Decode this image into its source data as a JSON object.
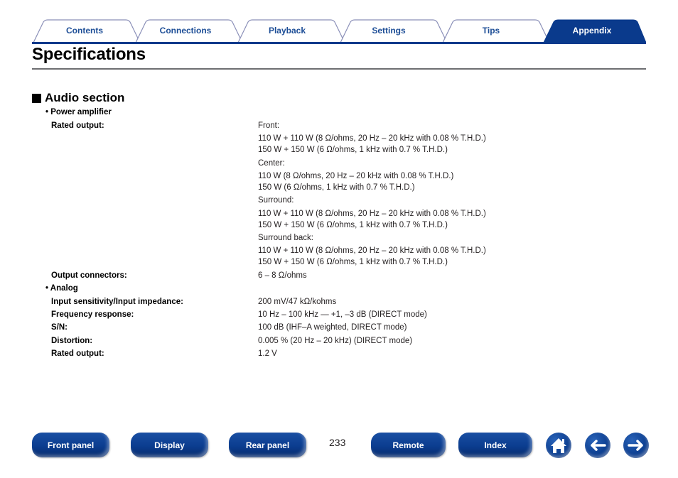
{
  "tabs": [
    {
      "label": "Contents",
      "active": false
    },
    {
      "label": "Connections",
      "active": false
    },
    {
      "label": "Playback",
      "active": false
    },
    {
      "label": "Settings",
      "active": false
    },
    {
      "label": "Tips",
      "active": false
    },
    {
      "label": "Appendix",
      "active": true
    }
  ],
  "colors": {
    "brand": "#0a3a8c",
    "tab_text": "#1c4d96",
    "tab_outline": "#8a8fb8"
  },
  "page_title": "Specifications",
  "section": {
    "title": "Audio section",
    "icon": "black-square",
    "power_amplifier": {
      "heading": "• Power amplifier",
      "rated_output_label": "Rated output:",
      "rated_output_values": [
        "Front:",
        "110 W + 110 W (8 Ω/ohms, 20 Hz – 20 kHz with 0.08 % T.H.D.)",
        "150 W + 150 W (6 Ω/ohms, 1 kHz with 0.7 % T.H.D.)",
        "Center:",
        "110 W (8 Ω/ohms, 20 Hz – 20 kHz with 0.08 % T.H.D.)",
        "150 W (6 Ω/ohms, 1 kHz with 0.7 % T.H.D.)",
        "Surround:",
        "110 W + 110 W (8 Ω/ohms, 20 Hz – 20 kHz with 0.08 % T.H.D.)",
        "150 W + 150 W (6 Ω/ohms, 1 kHz with 0.7 % T.H.D.)",
        "Surround back:",
        "110 W + 110 W (8 Ω/ohms, 20 Hz – 20 kHz with 0.08 % T.H.D.)",
        "150 W + 150 W (6 Ω/ohms, 1 kHz with 0.7 % T.H.D.)"
      ],
      "output_connectors_label": "Output connectors:",
      "output_connectors_value": "6 – 8 Ω/ohms"
    },
    "analog": {
      "heading": "• Analog",
      "rows": [
        {
          "label": "Input sensitivity/Input impedance:",
          "value": "200 mV/47 kΩ/kohms"
        },
        {
          "label": "Frequency response:",
          "value": "10 Hz – 100 kHz — +1, –3 dB (DIRECT mode)"
        },
        {
          "label": "S/N:",
          "value": "100 dB (IHF–A weighted, DIRECT mode)"
        },
        {
          "label": "Distortion:",
          "value": "0.005 % (20 Hz – 20 kHz) (DIRECT mode)"
        },
        {
          "label": "Rated output:",
          "value": "1.2 V"
        }
      ]
    }
  },
  "footer": {
    "buttons": [
      "Front panel",
      "Display",
      "Rear panel",
      "Remote",
      "Index"
    ],
    "page_number": "233",
    "icons": [
      "home-icon",
      "arrow-left-icon",
      "arrow-right-icon"
    ]
  }
}
